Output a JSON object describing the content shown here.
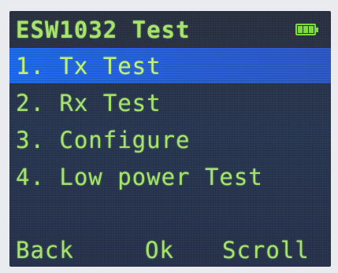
{
  "device": {
    "title": "ESW1032 Test",
    "battery_icon": "battery-full-icon",
    "colors": {
      "text": "#a6e36d",
      "selection": "#1e6cf0",
      "background": "#2b3a56",
      "battery": "#7cdc3a"
    }
  },
  "menu": {
    "items": [
      {
        "label": "1. Tx Test",
        "selected": true
      },
      {
        "label": "2. Rx Test",
        "selected": false
      },
      {
        "label": "3. Configure",
        "selected": false
      },
      {
        "label": "4. Low power Test",
        "selected": false
      }
    ]
  },
  "softkeys": {
    "back": "Back",
    "ok": "Ok",
    "scroll": "Scroll"
  }
}
